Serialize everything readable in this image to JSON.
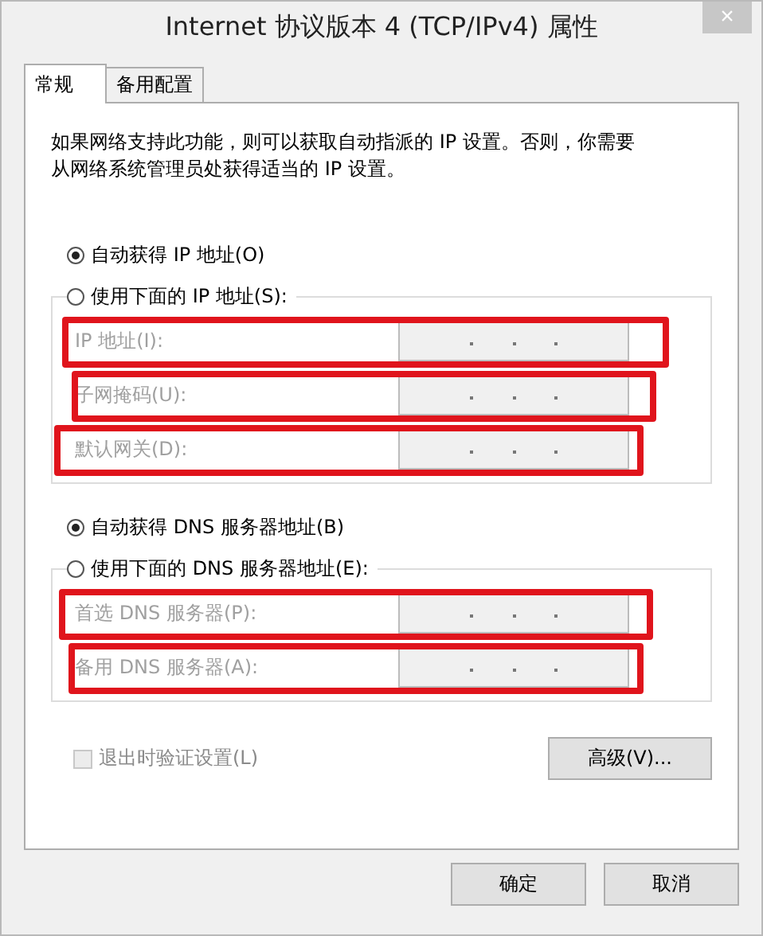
{
  "window": {
    "title": "Internet 协议版本 4 (TCP/IPv4) 属性",
    "close": "×"
  },
  "tabs": [
    {
      "label": "常规",
      "selected": true
    },
    {
      "label": "备用配置",
      "selected": false
    }
  ],
  "description": "如果网络支持此功能，则可以获取自动指派的 IP 设置。否则，你需要从网络系统管理员处获得适当的 IP 设置。",
  "sections": [
    {
      "options": [
        {
          "label": "自动获得 IP 地址(O)",
          "selected": true
        },
        {
          "label": "使用下面的 IP 地址(S):",
          "selected": false
        }
      ],
      "fields": [
        {
          "label": "IP 地址(I):",
          "disabled": true,
          "highlighted": true
        },
        {
          "label": "子网掩码(U):",
          "disabled": true,
          "highlighted": true
        },
        {
          "label": "默认网关(D):",
          "disabled": true,
          "highlighted": true
        }
      ]
    },
    {
      "options": [
        {
          "label": "自动获得 DNS 服务器地址(B)",
          "selected": true
        },
        {
          "label": "使用下面的 DNS 服务器地址(E):",
          "selected": false
        }
      ],
      "fields": [
        {
          "label": "首选 DNS 服务器(P):",
          "disabled": true,
          "highlighted": true
        },
        {
          "label": "备用 DNS 服务器(A):",
          "disabled": true,
          "highlighted": true
        }
      ]
    }
  ],
  "validate": {
    "label": "退出时验证设置(L)",
    "checked": false,
    "disabled": true
  },
  "advanced_button": "高级(V)...",
  "buttons": [
    "确定",
    "取消"
  ]
}
